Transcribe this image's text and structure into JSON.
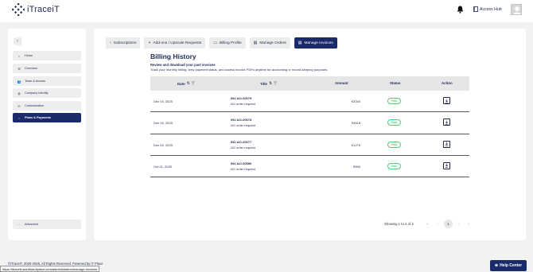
{
  "header": {
    "logo_text": "iTraceiT",
    "access_hub_label": "Access Hub"
  },
  "sidebar": {
    "collapse_icon": "chevron-left-icon",
    "items": [
      {
        "label": "Home",
        "icon": "home-icon"
      },
      {
        "label": "Overview",
        "icon": "list-icon"
      },
      {
        "label": "Team & Access",
        "icon": "team-icon"
      },
      {
        "label": "Company Identity",
        "icon": "globe-icon"
      },
      {
        "label": "Customization",
        "icon": "sliders-icon"
      },
      {
        "label": "Plans & Payments",
        "icon": "chevron-left-icon",
        "active": true
      }
    ],
    "advanced_label": "Advanced"
  },
  "tabs": [
    {
      "label": "Subscriptions",
      "icon": "chevron-left-icon"
    },
    {
      "label": "Add-ons / Upscale Requests",
      "icon": "plus-icon"
    },
    {
      "label": "Billing Profile",
      "icon": "card-icon"
    },
    {
      "label": "Manage Orders",
      "icon": "orders-icon"
    },
    {
      "label": "Manage Invoices",
      "icon": "invoice-icon",
      "active": true
    }
  ],
  "page": {
    "title": "Billing History",
    "subtitle": "Review and download your past invoices",
    "description": "Track your monthly billing, view payment status, and access invoice PDFs anytime for accounting or record-keeping purposes."
  },
  "table": {
    "columns": {
      "date": "Date",
      "title": "Title",
      "amount": "Amount",
      "status": "Status",
      "action": "Action"
    },
    "rows": [
      {
        "date": "Dec 04, 2025",
        "invoice": "INV-AO-00679",
        "type": "AO order request",
        "amount": "€2040",
        "status": "Paid"
      },
      {
        "date": "Dec 04, 2025",
        "invoice": "INV-AO-00678",
        "type": "AO order request",
        "amount": "€4818",
        "status": "Paid"
      },
      {
        "date": "Dec 04, 2025",
        "invoice": "INV-AO-00677",
        "type": "AO order request",
        "amount": "€1275",
        "status": "Paid"
      },
      {
        "date": "Oct 21, 2025",
        "invoice": "INV-AO-00580",
        "type": "AO order request",
        "amount": "€550",
        "status": "Paid"
      }
    ]
  },
  "pagination": {
    "info": "Showing 1 to 4 of 4",
    "first": "«",
    "prev": "‹",
    "current": "1",
    "next": "›",
    "last": "»"
  },
  "footer": {
    "copyright": "©iTraceiT, 2020-2025, All Rights Reserved. Powered by",
    "powered_by": "iT Place",
    "status_url": "https://itraceit-workflow.itplace.com/administration/manage-invoices"
  },
  "help_label": "Help Center",
  "colors": {
    "primary": "#1b2a6b",
    "paid": "#35b463",
    "background": "#f2f2f2"
  }
}
